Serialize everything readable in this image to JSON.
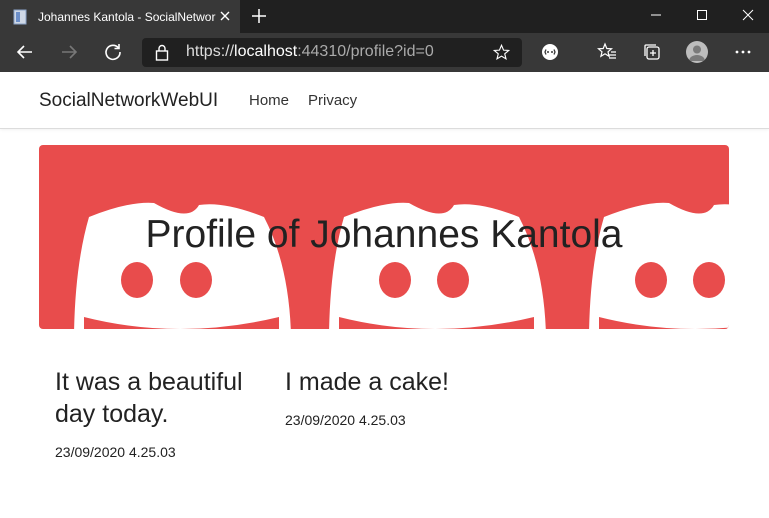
{
  "browser": {
    "tab_title": "Johannes Kantola - SocialNetwor",
    "url_scheme": "https://",
    "url_host": "localhost",
    "url_path": ":44310/profile?id=0"
  },
  "nav": {
    "brand": "SocialNetworkWebUI",
    "links": [
      "Home",
      "Privacy"
    ]
  },
  "profile": {
    "title": "Profile of Johannes Kantola",
    "banner_color": "#e84c4c"
  },
  "posts": [
    {
      "title": "It was a beautiful day today.",
      "date": "23/09/2020 4.25.03"
    },
    {
      "title": "I made a cake!",
      "date": "23/09/2020 4.25.03"
    }
  ],
  "icons": [
    "page-icon",
    "close-icon",
    "plus-icon",
    "minimize-icon",
    "maximize-icon",
    "window-close-icon",
    "back-icon",
    "forward-icon",
    "refresh-icon",
    "lock-icon",
    "favorite-star-icon",
    "extension-icon",
    "favorites-icon",
    "collections-icon",
    "profile-avatar-icon",
    "more-icon"
  ]
}
